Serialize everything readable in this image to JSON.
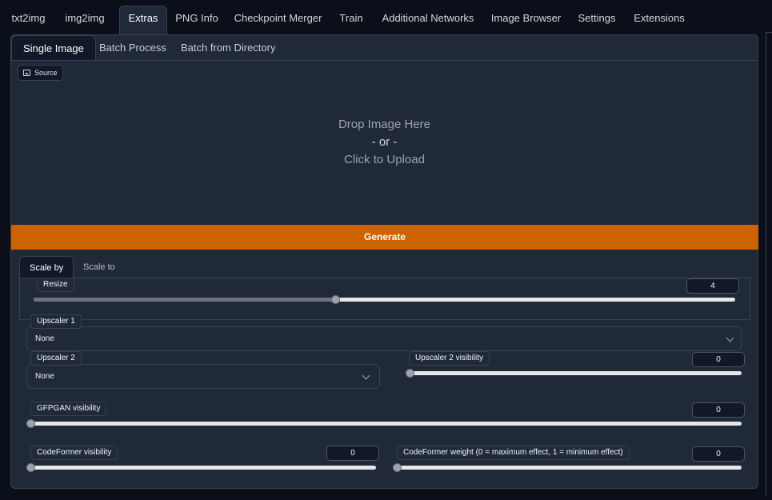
{
  "top_tabs": [
    "txt2img",
    "img2img",
    "Extras",
    "PNG Info",
    "Checkpoint Merger",
    "Train",
    "Additional Networks",
    "Image Browser",
    "Settings",
    "Extensions"
  ],
  "sub_tabs": [
    "Single Image",
    "Batch Process",
    "Batch from Directory"
  ],
  "source_label": "Source",
  "drop": {
    "line1": "Drop Image Here",
    "line2": "- or -",
    "line3": "Click to Upload"
  },
  "generate_label": "Generate",
  "scale_tabs": [
    "Scale by",
    "Scale to"
  ],
  "resize": {
    "label": "Resize",
    "value": "4",
    "min": 1,
    "max": 8
  },
  "upscaler1": {
    "label": "Upscaler 1",
    "value": "None"
  },
  "upscaler2": {
    "label": "Upscaler 2",
    "value": "None"
  },
  "upscaler2_visibility": {
    "label": "Upscaler 2 visibility",
    "value": "0"
  },
  "gfpgan": {
    "label": "GFPGAN visibility",
    "value": "0"
  },
  "codeformer_vis": {
    "label": "CodeFormer visibility",
    "value": "0"
  },
  "codeformer_weight": {
    "label": "CodeFormer weight (0 = maximum effect, 1 = minimum effect)",
    "value": "0"
  },
  "colors": {
    "accent": "#cc6300",
    "panel": "#1f2937",
    "background": "#0b0f19"
  }
}
